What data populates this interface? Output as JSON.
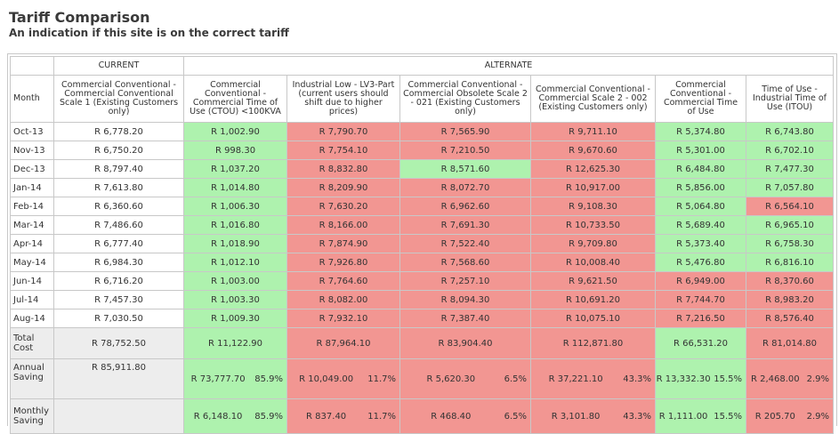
{
  "header": {
    "title": "Tariff Comparison",
    "subtitle": "An indication if this site is on the correct tariff"
  },
  "table": {
    "group_current": "CURRENT",
    "group_alternate": "ALTERNATE",
    "col_month": "Month",
    "columns": [
      "Commercial Conventional - Commercial Conventional Scale 1 (Existing Customers only)",
      "Commercial Conventional - Commercial Time of Use (CTOU) <100KVA",
      "Industrial Low - LV3-Part (current users should shift due to higher prices)",
      "Commercial Conventional - Commercial Obsolete Scale 2 - 021 (Existing Customers only)",
      "Commercial Conventional - Commercial Scale 2 - 002 (Existing Customers only)",
      "Commercial Conventional - Commercial Time of Use",
      "Time of Use - Industrial Time of Use (ITOU)"
    ],
    "rows": [
      {
        "month": "Oct-13",
        "values": [
          "R 6,778.20",
          "R 1,002.90",
          "R 7,790.70",
          "R 7,565.90",
          "R 9,711.10",
          "R 5,374.80",
          "R 6,743.80"
        ],
        "colors": [
          "",
          "g",
          "r",
          "r",
          "r",
          "g",
          "g"
        ]
      },
      {
        "month": "Nov-13",
        "values": [
          "R 6,750.20",
          "R 998.30",
          "R 7,754.10",
          "R 7,210.50",
          "R 9,670.60",
          "R 5,301.00",
          "R 6,702.10"
        ],
        "colors": [
          "",
          "g",
          "r",
          "r",
          "r",
          "g",
          "g"
        ]
      },
      {
        "month": "Dec-13",
        "values": [
          "R 8,797.40",
          "R 1,037.20",
          "R 8,832.80",
          "R 8,571.60",
          "R 12,625.30",
          "R 6,484.80",
          "R 7,477.30"
        ],
        "colors": [
          "",
          "g",
          "r",
          "g",
          "r",
          "g",
          "g"
        ]
      },
      {
        "month": "Jan-14",
        "values": [
          "R 7,613.80",
          "R 1,014.80",
          "R 8,209.90",
          "R 8,072.70",
          "R 10,917.00",
          "R 5,856.00",
          "R 7,057.80"
        ],
        "colors": [
          "",
          "g",
          "r",
          "r",
          "r",
          "g",
          "g"
        ]
      },
      {
        "month": "Feb-14",
        "values": [
          "R 6,360.60",
          "R 1,006.30",
          "R 7,630.20",
          "R 6,962.60",
          "R 9,108.30",
          "R 5,064.80",
          "R 6,564.10"
        ],
        "colors": [
          "",
          "g",
          "r",
          "r",
          "r",
          "g",
          "r"
        ]
      },
      {
        "month": "Mar-14",
        "values": [
          "R 7,486.60",
          "R 1,016.80",
          "R 8,166.00",
          "R 7,691.30",
          "R 10,733.50",
          "R 5,689.40",
          "R 6,965.10"
        ],
        "colors": [
          "",
          "g",
          "r",
          "r",
          "r",
          "g",
          "g"
        ]
      },
      {
        "month": "Apr-14",
        "values": [
          "R 6,777.40",
          "R 1,018.90",
          "R 7,874.90",
          "R 7,522.40",
          "R 9,709.80",
          "R 5,373.40",
          "R 6,758.30"
        ],
        "colors": [
          "",
          "g",
          "r",
          "r",
          "r",
          "g",
          "g"
        ]
      },
      {
        "month": "May-14",
        "values": [
          "R 6,984.30",
          "R 1,012.10",
          "R 7,926.80",
          "R 7,568.60",
          "R 10,008.40",
          "R 5,476.80",
          "R 6,816.10"
        ],
        "colors": [
          "",
          "g",
          "r",
          "r",
          "r",
          "g",
          "g"
        ]
      },
      {
        "month": "Jun-14",
        "values": [
          "R 6,716.20",
          "R 1,003.00",
          "R 7,764.60",
          "R 7,257.10",
          "R 9,621.50",
          "R 6,949.00",
          "R 8,370.60"
        ],
        "colors": [
          "",
          "g",
          "r",
          "r",
          "r",
          "r",
          "r"
        ]
      },
      {
        "month": "Jul-14",
        "values": [
          "R 7,457.30",
          "R 1,003.30",
          "R 8,082.00",
          "R 8,094.30",
          "R 10,691.20",
          "R 7,744.70",
          "R 8,983.20"
        ],
        "colors": [
          "",
          "g",
          "r",
          "r",
          "r",
          "r",
          "r"
        ]
      },
      {
        "month": "Aug-14",
        "values": [
          "R 7,030.50",
          "R 1,009.30",
          "R 7,932.10",
          "R 7,387.40",
          "R 10,075.10",
          "R 7,216.50",
          "R 8,576.40"
        ],
        "colors": [
          "",
          "g",
          "r",
          "r",
          "r",
          "r",
          "r"
        ]
      }
    ],
    "total": {
      "label": "Total Cost",
      "values": [
        "R 78,752.50",
        "R 11,122.90",
        "R 87,964.10",
        "R 83,904.40",
        "R 112,871.80",
        "R 66,531.20",
        "R 81,014.80"
      ],
      "colors": [
        "gray",
        "g",
        "r",
        "r",
        "r",
        "g",
        "r"
      ]
    },
    "annual": {
      "label": "Annual Saving",
      "current": "R 85,911.80",
      "values": [
        "R 73,777.70",
        "R 10,049.00",
        "R 5,620.30",
        "R 37,221.10",
        "R 13,332.30",
        "R 2,468.00"
      ],
      "pcts": [
        "85.9%",
        "11.7%",
        "6.5%",
        "43.3%",
        "15.5%",
        "2.9%"
      ],
      "colors": [
        "g",
        "r",
        "r",
        "r",
        "g",
        "r"
      ]
    },
    "monthly": {
      "label": "Monthly Saving",
      "current": "",
      "values": [
        "R 6,148.10",
        "R 837.40",
        "R 468.40",
        "R 3,101.80",
        "R 1,111.00",
        "R 205.70"
      ],
      "pcts": [
        "85.9%",
        "11.7%",
        "6.5%",
        "43.3%",
        "15.5%",
        "2.9%"
      ],
      "colors": [
        "g",
        "r",
        "r",
        "r",
        "g",
        "r"
      ]
    },
    "colors": {
      "green": "#aef2ae",
      "red": "#f29692",
      "gray": "#ededed"
    }
  }
}
